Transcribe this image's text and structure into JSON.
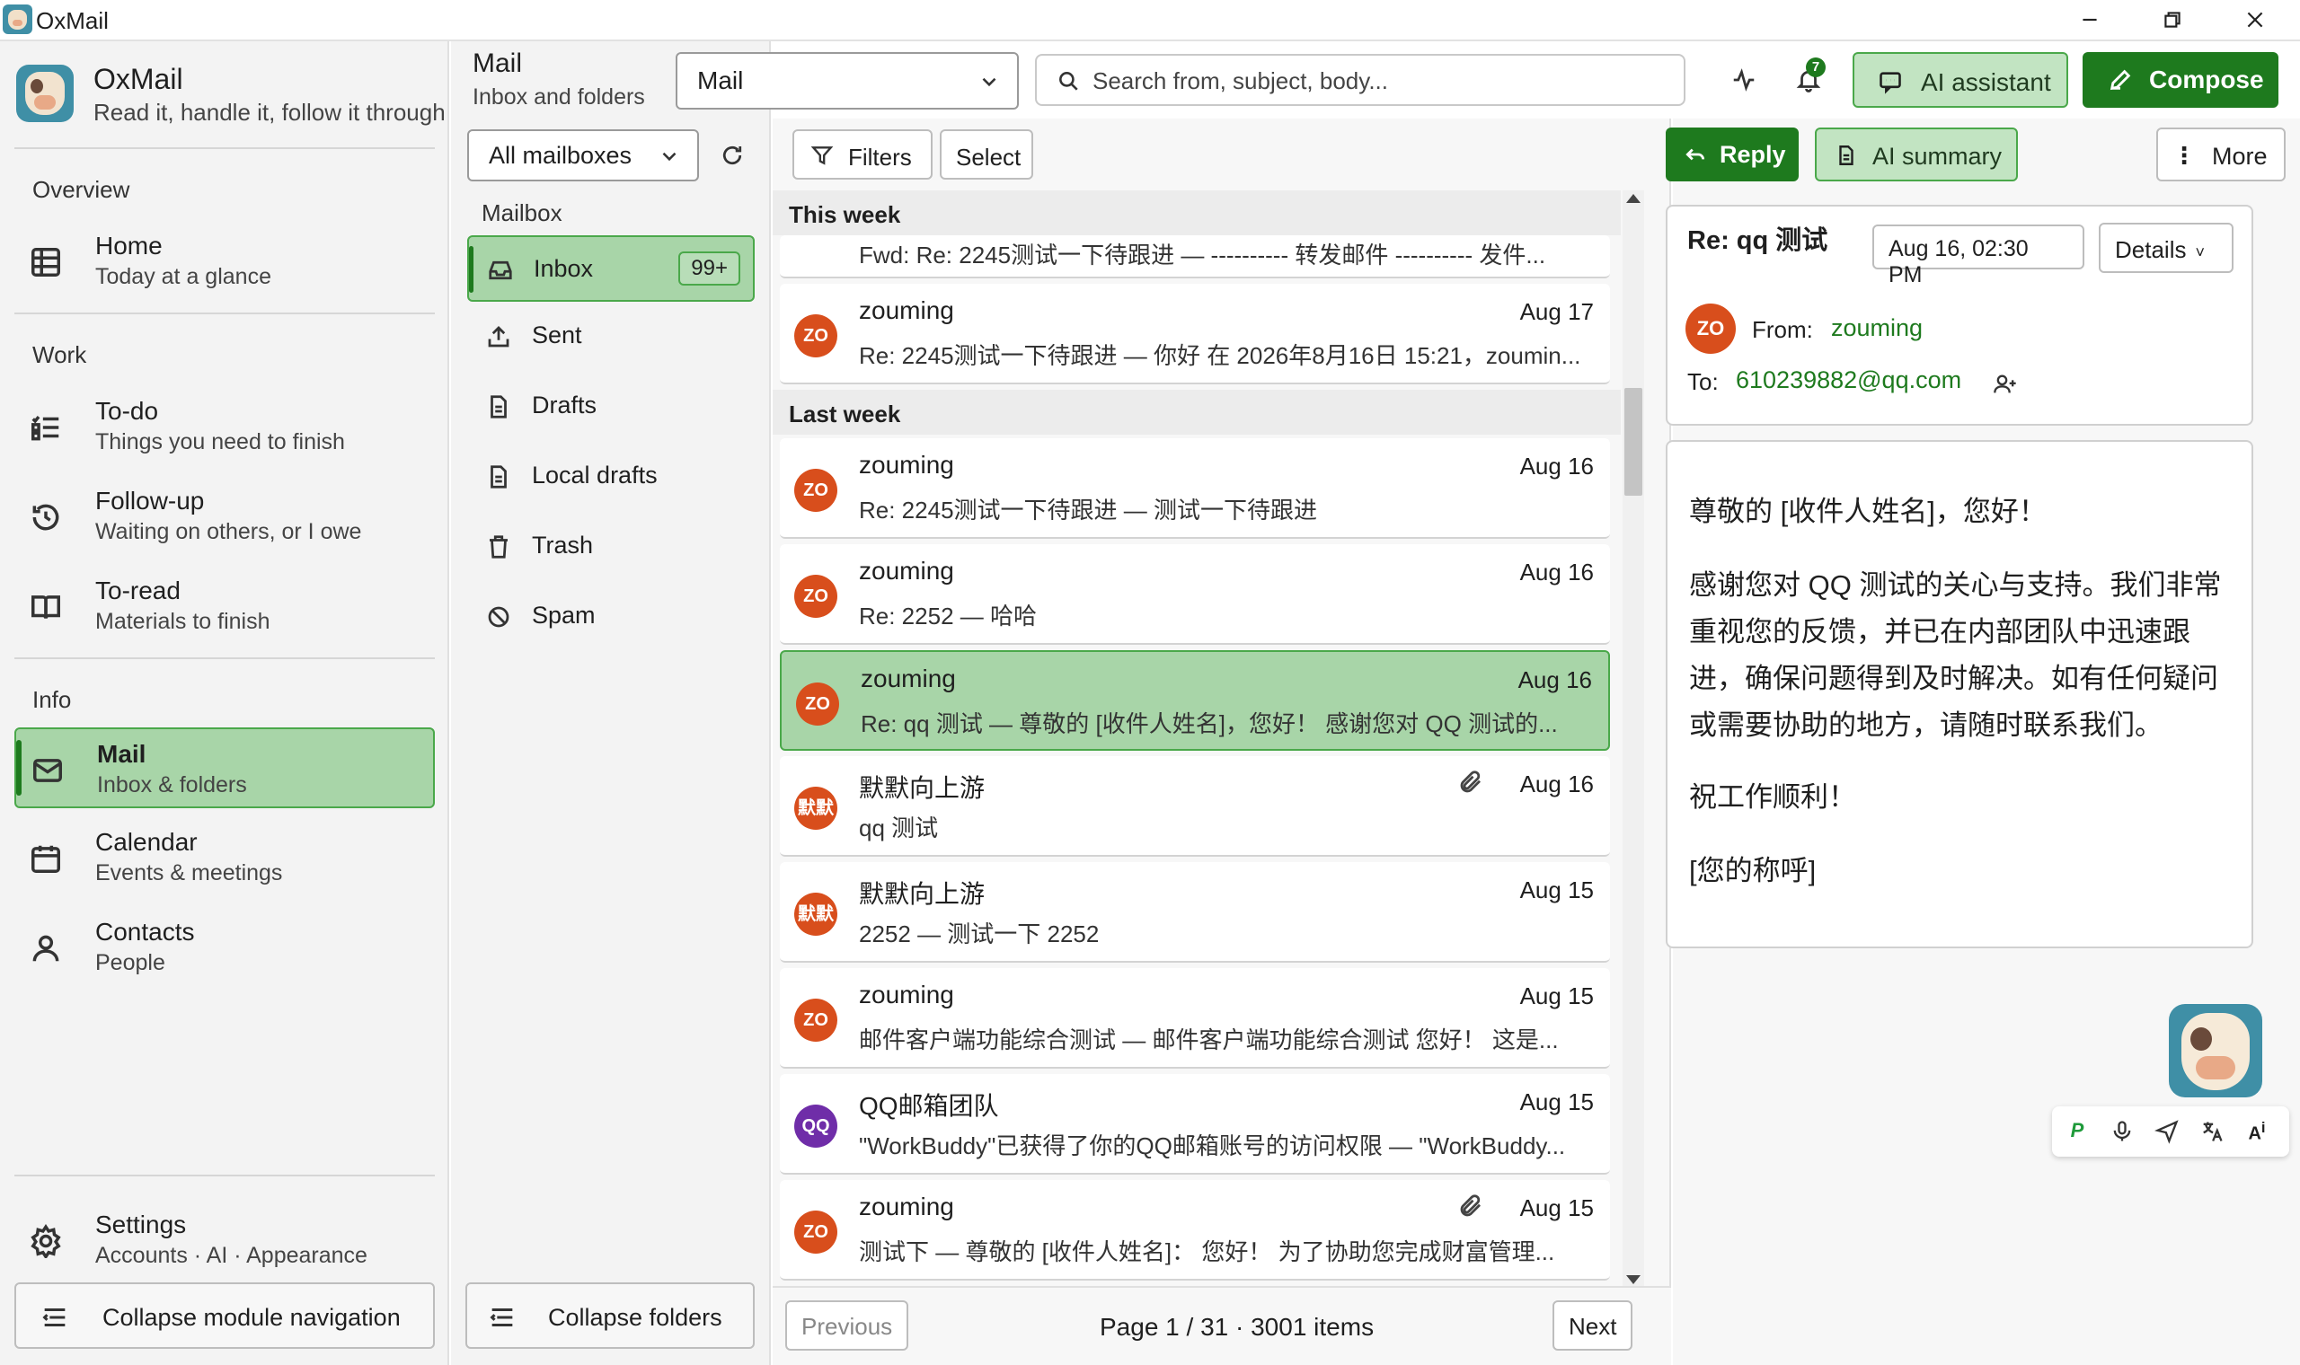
{
  "window": {
    "title": "OxMail"
  },
  "brand": {
    "name": "OxMail",
    "tagline": "Read it, handle it, follow it through"
  },
  "nav": {
    "overview_label": "Overview",
    "home": {
      "title": "Home",
      "sub": "Today at a glance"
    },
    "work_label": "Work",
    "todo": {
      "title": "To-do",
      "sub": "Things you need to finish"
    },
    "followup": {
      "title": "Follow-up",
      "sub": "Waiting on others, or I owe"
    },
    "toread": {
      "title": "To-read",
      "sub": "Materials to finish"
    },
    "info_label": "Info",
    "mail": {
      "title": "Mail",
      "sub": "Inbox & folders"
    },
    "calendar": {
      "title": "Calendar",
      "sub": "Events & meetings"
    },
    "contacts": {
      "title": "Contacts",
      "sub": "People"
    },
    "settings": {
      "title": "Settings",
      "sub": "Accounts · AI · Appearance"
    },
    "collapse_label": "Collapse module navigation"
  },
  "header": {
    "title": "Mail",
    "subtitle": "Inbox and folders",
    "mode_select": "Mail",
    "search_placeholder": "Search from, subject, body...",
    "notification_count": "7",
    "ai_assistant_label": "AI assistant",
    "compose_label": "Compose"
  },
  "folders": {
    "mailbox_select": "All mailboxes",
    "section_label": "Mailbox",
    "items": [
      {
        "label": "Inbox",
        "count": "99+",
        "icon": "inbox-icon"
      },
      {
        "label": "Sent",
        "icon": "sent-icon"
      },
      {
        "label": "Drafts",
        "icon": "drafts-icon"
      },
      {
        "label": "Local drafts",
        "icon": "local-drafts-icon"
      },
      {
        "label": "Trash",
        "icon": "trash-icon"
      },
      {
        "label": "Spam",
        "icon": "spam-icon"
      }
    ],
    "collapse_label": "Collapse folders"
  },
  "list": {
    "filters_label": "Filters",
    "select_label": "Select",
    "groups": [
      "This week",
      "Last week"
    ],
    "partial_top": {
      "subject": "Fwd: Re: 2245测试一下待跟进 — ---------- 转发邮件 ---------- 发件..."
    },
    "messages": [
      {
        "avatar": "ZO",
        "from": "zouming",
        "date": "Aug 17",
        "subject": "Re: 2245测试一下待跟进 — 你好 在 2026年8月16日 15:21，zoumin..."
      },
      {
        "avatar": "ZO",
        "from": "zouming",
        "date": "Aug 16",
        "subject": "Re: 2245测试一下待跟进 — 测试一下待跟进"
      },
      {
        "avatar": "ZO",
        "from": "zouming",
        "date": "Aug 16",
        "subject": "Re: 2252 — 哈哈"
      },
      {
        "avatar": "ZO",
        "from": "zouming",
        "date": "Aug 16",
        "subject": "Re: qq 测试 — 尊敬的 [收件人姓名]，您好！ 感谢您对 QQ 测试的..."
      },
      {
        "avatar": "默默",
        "from": "默默向上游",
        "date": "Aug 16",
        "subject": "qq 测试"
      },
      {
        "avatar": "默默",
        "from": "默默向上游",
        "date": "Aug 15",
        "subject": "2252 — 测试一下 2252"
      },
      {
        "avatar": "ZO",
        "from": "zouming",
        "date": "Aug 15",
        "subject": "邮件客户端功能综合测试 — 邮件客户端功能综合测试 您好！ 这是..."
      },
      {
        "avatar": "QQ",
        "from": "QQ邮箱团队",
        "date": "Aug 15",
        "subject": "\"WorkBuddy\"已获得了你的QQ邮箱账号的访问权限 — \"WorkBuddy..."
      },
      {
        "avatar": "ZO",
        "from": "zouming",
        "date": "Aug 15",
        "subject": "测试下 — 尊敬的 [收件人姓名]： 您好！ 为了协助您完成财富管理..."
      }
    ],
    "pager": {
      "previous": "Previous",
      "info": "Page 1 / 31 · 3001 items",
      "next": "Next"
    }
  },
  "reader": {
    "reply_label": "Reply",
    "summary_label": "AI summary",
    "more_label": "More",
    "subject": "Re: qq 测试",
    "date": "Aug 16, 02:30 PM",
    "details_label": "Details",
    "from_avatar": "ZO",
    "from_label": "From:",
    "from_value": "zouming",
    "to_label": "To:",
    "to_value": "610239882@qq.com",
    "body": [
      "尊敬的 [收件人姓名]，您好！",
      "感谢您对 QQ 测试的关心与支持。我们非常重视您的反馈，并已在内部团队中迅速跟进，确保问题得到及时解决。如有任何疑问或需要协助的地方，请随时联系我们。",
      "祝工作顺利！",
      "[您的称呼]"
    ]
  },
  "colors": {
    "accent": "#1e7a1e",
    "accent_light": "#a8d5a8",
    "avatar_orange": "#d84e1c",
    "avatar_purple": "#6f2da8"
  }
}
